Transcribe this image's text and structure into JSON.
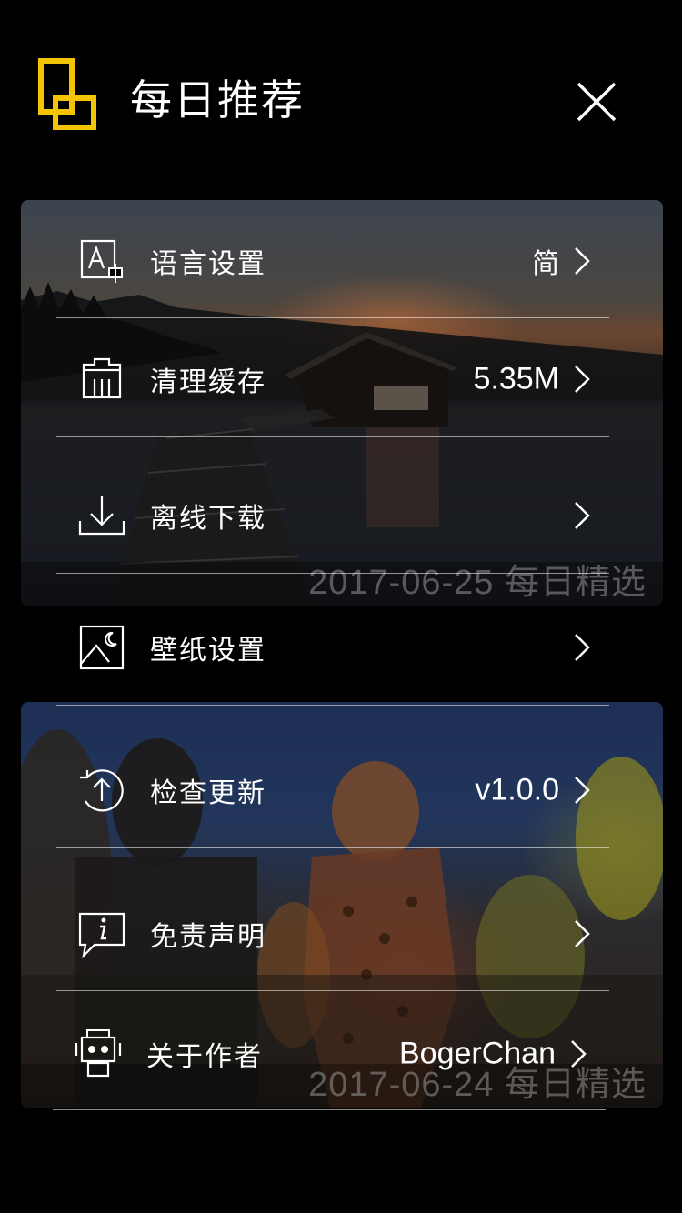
{
  "header": {
    "title": "每日推荐",
    "logo_icon": "app-logo-icon",
    "close_icon": "close-icon"
  },
  "cards": [
    {
      "date": "2017-06-25 每日精选"
    },
    {
      "date": "2017-06-24 每日精选"
    }
  ],
  "settings": [
    {
      "label": "语言设置",
      "value": "简",
      "icon": "language-icon"
    },
    {
      "label": "清理缓存",
      "value": "5.35M",
      "icon": "clear-cache-icon"
    },
    {
      "label": "离线下载",
      "value": "",
      "icon": "download-icon"
    },
    {
      "label": "壁纸设置",
      "value": "",
      "icon": "wallpaper-icon"
    },
    {
      "label": "检查更新",
      "value": "v1.0.0",
      "icon": "update-icon"
    },
    {
      "label": "免责声明",
      "value": "",
      "icon": "disclaimer-icon"
    },
    {
      "label": "关于作者",
      "value": "BogerChan",
      "icon": "robot-icon"
    }
  ],
  "colors": {
    "accent": "#F5C400",
    "background": "#000000",
    "text": "#FFFFFF",
    "divider": "#8C8C8C"
  }
}
